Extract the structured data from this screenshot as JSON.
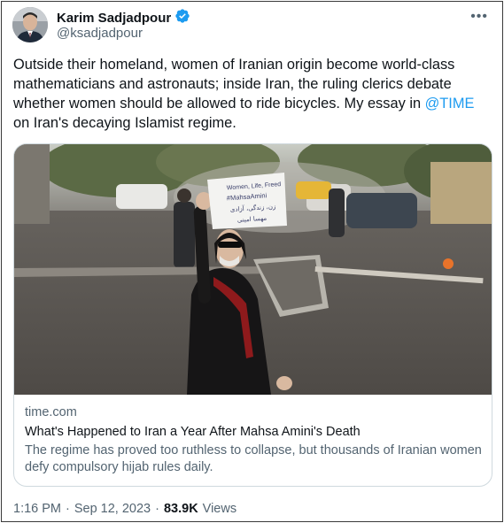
{
  "author": {
    "name": "Karim Sadjadpour",
    "handle": "@ksadjadpour",
    "verified_color": "#1d9bf0"
  },
  "more_icon": "more-horizontal-icon",
  "tweet": {
    "text_before_mention": "Outside their homeland, women of Iranian origin become world-class mathematicians and astronauts; inside Iran, the ruling clerics debate whether women should be allowed to ride bicycles. My essay in ",
    "mention": "@TIME",
    "text_after_mention": " on Iran's decaying Islamist regime."
  },
  "card": {
    "domain": "time.com",
    "title": "What's Happened to Iran a Year After Mahsa Amini's Death",
    "description": "The regime has proved too ruthless to collapse, but thousands of Iranian women defy compulsory hijab rules daily.",
    "image": {
      "sign_line1": "Women, Life, Freed",
      "sign_line2": "#MahsaAmini",
      "sign_line3": "زن، زندگی، آزادی",
      "sign_line4": "مهسا امینی"
    }
  },
  "meta": {
    "time": "1:16 PM",
    "separator": "·",
    "date": "Sep 12, 2023",
    "views_count": "83.9K",
    "views_label": "Views"
  },
  "colors": {
    "text": "#0f1419",
    "secondary": "#536471",
    "link": "#1d9bf0",
    "border": "#cfd9de"
  }
}
